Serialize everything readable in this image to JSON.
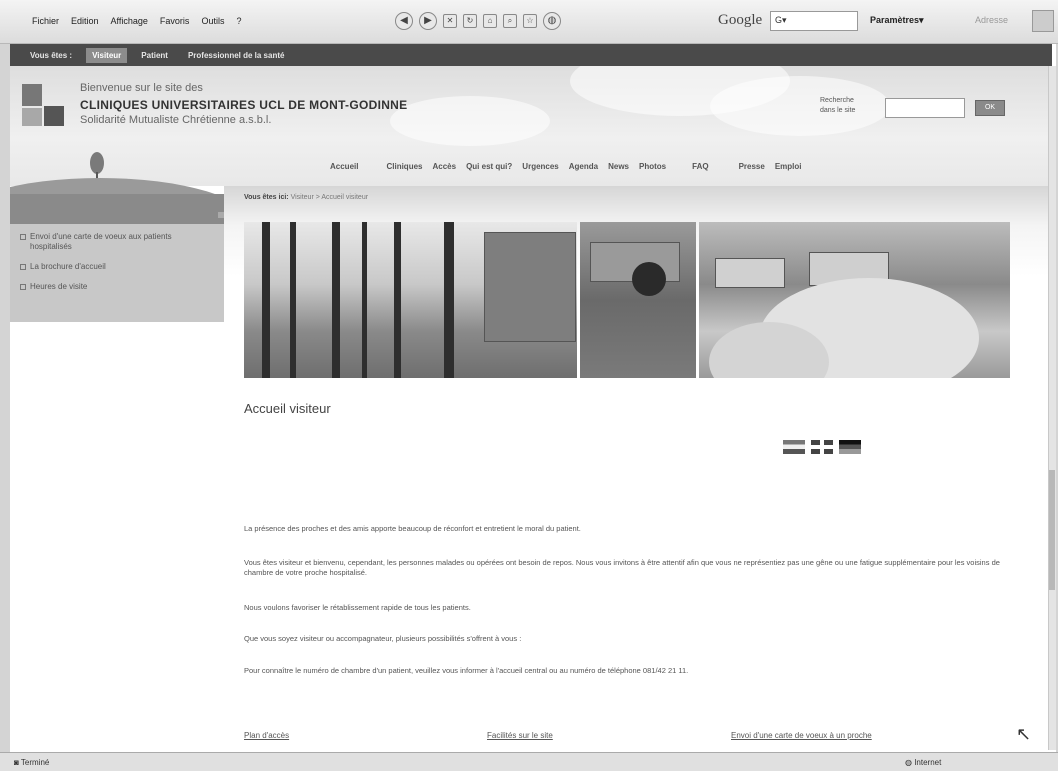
{
  "browser": {
    "menu": [
      "Fichier",
      "Edition",
      "Affichage",
      "Favoris",
      "Outils",
      "?"
    ],
    "google_label": "Google",
    "google_search_value": "G▾",
    "parametres": "Paramètres▾",
    "address_label": "Adresse"
  },
  "site_nav": [
    "Vous êtes :",
    "Visiteur",
    "Patient",
    "Professionnel de la santé"
  ],
  "header": {
    "welcome": "Bienvenue sur le site des",
    "clinic_name": "CLINIQUES UNIVERSITAIRES UCL DE MONT-GODINNE",
    "subtitle": "Solidarité Mutualiste Chrétienne a.s.b.l.",
    "search_label_1": "Recherche",
    "search_label_2": "dans le site",
    "search_button": "OK"
  },
  "main_menu": [
    "Accueil",
    "Cliniques",
    "Accès",
    "Qui est qui?",
    "Urgences",
    "Agenda",
    "News",
    "Photos",
    "FAQ",
    "Presse",
    "Emploi"
  ],
  "breadcrumb": {
    "prefix": "Vous êtes ici:",
    "path": "Visiteur > Accueil visiteur"
  },
  "sidebar": [
    "Envoi d'une carte de voeux aux patients hospitalisés",
    "La brochure d'accueil",
    "Heures de visite"
  ],
  "page": {
    "heading": "Accueil visiteur",
    "paragraphs": [
      "La présence des proches et des amis apporte beaucoup de réconfort et entretient le moral du patient.",
      "Vous êtes visiteur et bienvenu, cependant, les personnes malades ou opérées ont besoin de repos. Nous vous invitons à être attentif afin que vous ne représentiez pas une gêne ou une fatigue supplémentaire pour les voisins de chambre de votre proche hospitalisé.",
      "Nous voulons favoriser le rétablissement rapide de tous les patients.",
      "Que vous soyez visiteur ou accompagnateur, plusieurs possibilités s'offrent à vous :",
      "Pour connaître le numéro de chambre d'un patient, veuillez vous informer à l'accueil central ou au numéro de téléphone 081/42 21 11."
    ]
  },
  "flags": [
    "nl-flag",
    "uk-flag",
    "de-flag"
  ],
  "footer_links": [
    "Plan d'accès",
    "Facilités sur le site",
    "Envoi d'une carte de voeux à un proche"
  ],
  "status": {
    "left": "Terminé",
    "right": "Internet"
  }
}
